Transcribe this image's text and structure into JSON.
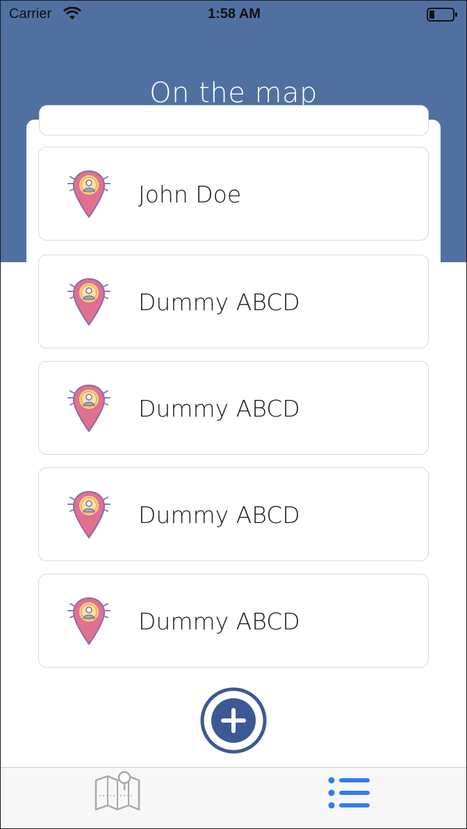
{
  "status_bar": {
    "carrier": "Carrier",
    "time": "1:58 AM"
  },
  "header": {
    "title": "On the map",
    "color": "#5170a2"
  },
  "people": [
    {
      "name": "John Doe"
    },
    {
      "name": "Dummy ABCD"
    },
    {
      "name": "Dummy ABCD"
    },
    {
      "name": "Dummy ABCD"
    },
    {
      "name": "Dummy ABCD"
    }
  ],
  "icons": {
    "person_pin": "person-pin-icon",
    "add": "plus-circle-icon",
    "map_tab": "map-icon",
    "list_tab": "list-icon"
  },
  "colors": {
    "pin": "#e0708f",
    "accent": "#3478f6",
    "add_button": "#3d5994"
  },
  "tabs": [
    {
      "id": "map",
      "active": false
    },
    {
      "id": "list",
      "active": true
    }
  ]
}
